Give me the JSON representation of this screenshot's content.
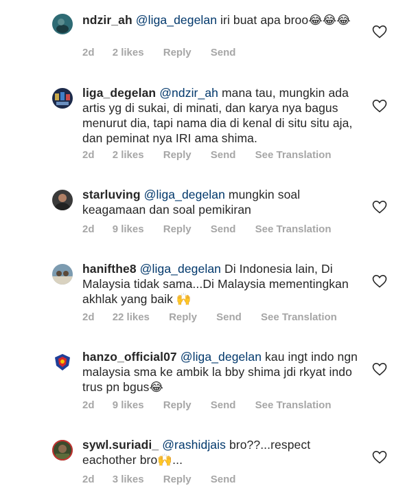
{
  "comments": [
    {
      "username": "ndzir_ah",
      "mention": "@liga_degelan",
      "text": "iri buat apa broo😂😂😂",
      "time": "2d",
      "likes": "2 likes",
      "reply": "Reply",
      "send": "Send",
      "translation": "",
      "avatar_color": "#2e6b74"
    },
    {
      "username": "liga_degelan",
      "mention": "@ndzir_ah",
      "text": "mana tau, mungkin ada artis yg di sukai, di minati, dan karya nya bagus menurut dia, tapi nama dia di kenal di situ situ aja, dan peminat nya IRI ama shima.",
      "time": "2d",
      "likes": "2 likes",
      "reply": "Reply",
      "send": "Send",
      "translation": "See Translation",
      "avatar_color": "#1c2a4a"
    },
    {
      "username": "starluving",
      "mention": "@liga_degelan",
      "text": "mungkin soal keagamaan dan soal pemikiran",
      "time": "2d",
      "likes": "9 likes",
      "reply": "Reply",
      "send": "Send",
      "translation": "See Translation",
      "avatar_color": "#3a3a3a"
    },
    {
      "username": "hanifthe8",
      "mention": "@liga_degelan",
      "text": "Di Indonesia lain, Di Malaysia tidak sama...Di Malaysia mementingkan akhlak yang baik 🙌",
      "time": "2d",
      "likes": "22 likes",
      "reply": "Reply",
      "send": "Send",
      "translation": "See Translation",
      "avatar_color": "#7c9bb0"
    },
    {
      "username": "hanzo_official07",
      "mention": "@liga_degelan",
      "text": "kau ingt indo ngn malaysia sma ke ambik la bby shima jdi rkyat indo trus pn bgus😂",
      "time": "2d",
      "likes": "9 likes",
      "reply": "Reply",
      "send": "Send",
      "translation": "See Translation",
      "avatar_color": "#1e3f99"
    },
    {
      "username": "sywl.suriadi_",
      "mention": "@rashidjais",
      "text": "bro??...respect eachother bro🙌...",
      "time": "2d",
      "likes": "3 likes",
      "reply": "Reply",
      "send": "Send",
      "translation": "",
      "avatar_color": "#3b4a2c"
    }
  ]
}
